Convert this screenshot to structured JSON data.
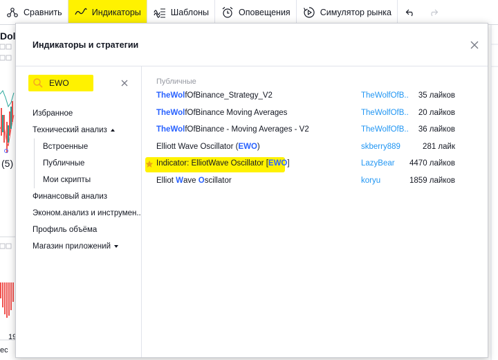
{
  "toolbar": {
    "items": [
      {
        "label": "Сравнить",
        "icon": "compare-icon"
      },
      {
        "label": "Индикаторы",
        "icon": "indicators-icon"
      },
      {
        "label": "Шаблоны",
        "icon": "templates-icon"
      },
      {
        "label": "Оповещения",
        "icon": "alarm-clock-icon"
      },
      {
        "label": "Симулятор рынка",
        "icon": "replay-icon"
      }
    ],
    "undo_icon": "undo-icon",
    "redo_icon": "redo-icon"
  },
  "background": {
    "title_fragment": "Dol",
    "wave_label": "(5)",
    "bottom_label": "ес",
    "bottom_label2": "19"
  },
  "dialog": {
    "title": "Индикаторы и стратегии",
    "close_icon": "close-icon",
    "search": {
      "value": "EWO",
      "icon": "search-icon",
      "clear_icon": "clear-icon"
    },
    "categories": [
      {
        "label": "Избранное",
        "level": 0
      },
      {
        "label": "Технический анализ",
        "level": 0,
        "caret": "up"
      },
      {
        "label": "Встроенные",
        "level": 1
      },
      {
        "label": "Публичные",
        "level": 1
      },
      {
        "label": "Мои скрипты",
        "level": 1
      },
      {
        "label": "Финансовый анализ",
        "level": 0
      },
      {
        "label": "Эконом.анализ и инструмен...",
        "level": 0
      },
      {
        "label": "Профиль объёма",
        "level": 0
      },
      {
        "label": "Магазин приложений",
        "level": 0,
        "caret": "down"
      }
    ],
    "section_label": "Публичные",
    "results": [
      {
        "name_parts": [
          "The",
          "Wol",
          "fOfBinance_Strategy_V2"
        ],
        "author": "TheWolfOfB...",
        "likes": "35 лайков"
      },
      {
        "name_parts": [
          "The",
          "Wol",
          "fOfBinance Moving Averages"
        ],
        "author": "TheWolfOfB...",
        "likes": "20 лайков"
      },
      {
        "name_parts": [
          "The",
          "Wol",
          "fOfBinance - Moving Averages - V2"
        ],
        "author": "TheWolfOfB...",
        "likes": "36 лайков"
      },
      {
        "name_parts": [
          "Elliott Wave Oscillator (",
          "EWO",
          ")"
        ],
        "author": "skberry889",
        "likes": "281 лайк"
      },
      {
        "name_parts": [
          "Indicator: ElliotWave Oscillator [",
          "EWO",
          "]"
        ],
        "author": "LazyBear",
        "likes": "4470 лайков",
        "favorite": true
      },
      {
        "name_parts": [
          "Elliot ",
          "W",
          "ave ",
          "O",
          "scillator"
        ],
        "author": "koryu",
        "likes": "1859 лайков"
      }
    ],
    "highlight_color": "#fff200",
    "accent_color": "#2962ff",
    "author_color": "#2196f3"
  }
}
